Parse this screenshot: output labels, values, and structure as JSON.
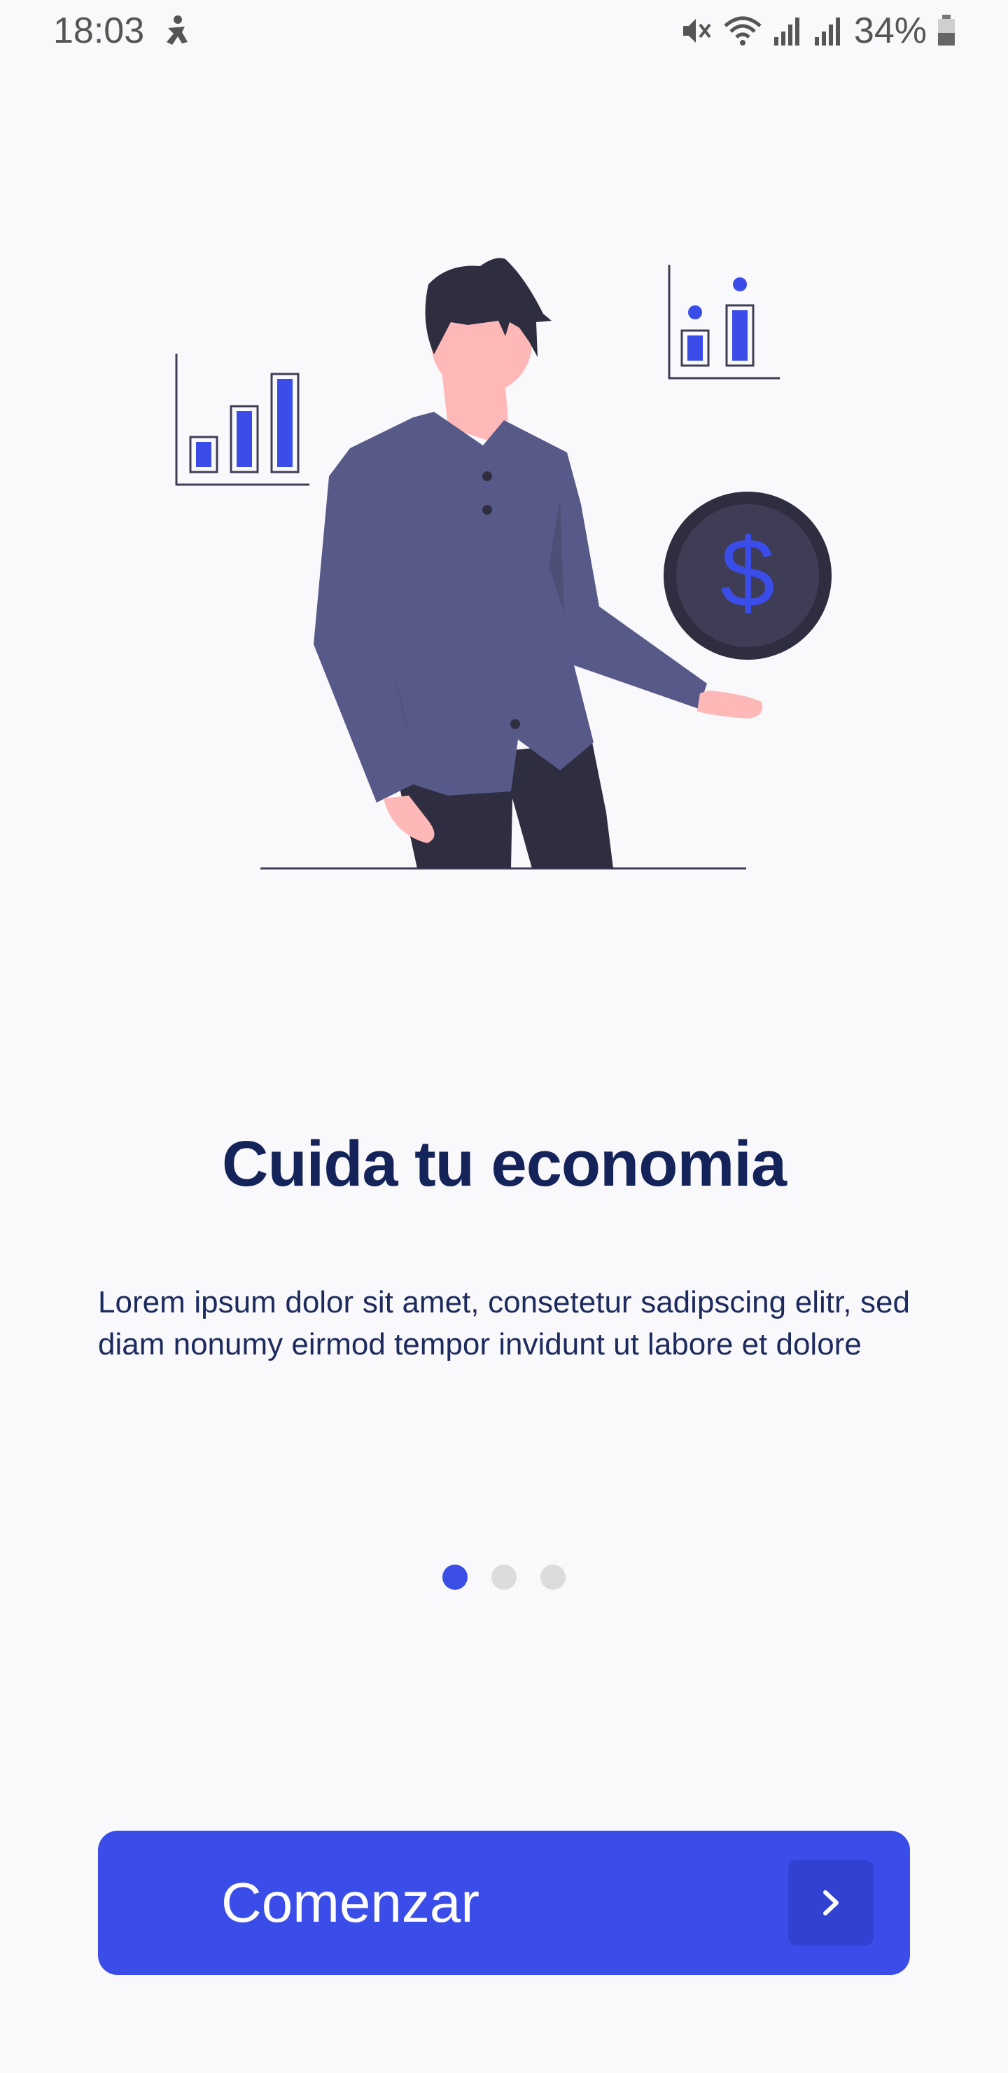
{
  "status_bar": {
    "time": "18:03",
    "battery": "34%"
  },
  "onboarding": {
    "title": "Cuida tu economia",
    "description": "Lorem ipsum dolor sit amet, consetetur sadipscing elitr, sed diam nonumy eirmod tempor invidunt ut labore et dolore",
    "pages": 3,
    "active_page": 1
  },
  "cta": {
    "label": "Comenzar",
    "icon": "chevron-right-icon"
  },
  "colors": {
    "primary": "#3a4de8",
    "title": "#142359",
    "background": "#f9f9fb"
  }
}
